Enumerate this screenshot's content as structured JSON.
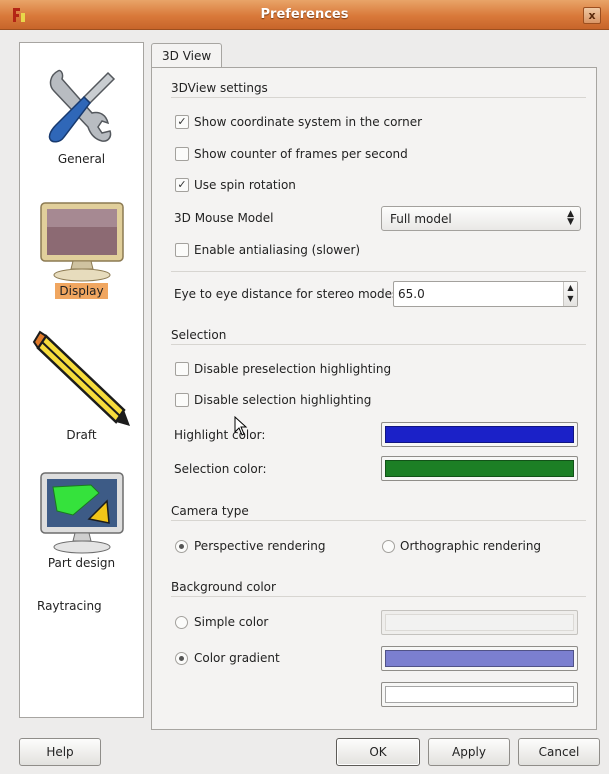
{
  "window": {
    "title": "Preferences",
    "close_glyph": "x"
  },
  "sidebar": {
    "items": [
      {
        "label": "General",
        "icon": "wrench-screwdriver-icon"
      },
      {
        "label": "Display",
        "icon": "monitor-icon",
        "selected": true
      },
      {
        "label": "Draft",
        "icon": "pencil-icon"
      },
      {
        "label": "Part design",
        "icon": "part-design-monitor-icon"
      },
      {
        "label": "Raytracing"
      }
    ]
  },
  "tabs": [
    {
      "label": "3D View"
    }
  ],
  "view3d": {
    "title": "3DView settings",
    "show_coordinate": {
      "label": "Show coordinate system in the corner",
      "checked": true,
      "glyph": "✓"
    },
    "show_fps": {
      "label": "Show counter of frames per second",
      "checked": false
    },
    "spin_rotation": {
      "label": "Use spin rotation",
      "checked": true,
      "glyph": "✓"
    },
    "mouse_model": {
      "label": "3D Mouse Model",
      "value": "Full model",
      "arrows": "▲\n▼"
    },
    "antialiasing": {
      "label": "Enable antialiasing (slower)",
      "checked": false
    },
    "eye_distance": {
      "label": "Eye to eye distance for stereo modes:",
      "value": "65.0",
      "arrows": "▲\n▼"
    }
  },
  "selection": {
    "title": "Selection",
    "disable_preselection": {
      "label": "Disable preselection highlighting",
      "checked": false
    },
    "disable_selection": {
      "label": "Disable selection highlighting",
      "checked": false
    },
    "highlight_color": {
      "label": "Highlight color:",
      "color": "#1b21c8"
    },
    "selection_color": {
      "label": "Selection color:",
      "color": "#1c7f25"
    }
  },
  "camera": {
    "title": "Camera type",
    "perspective": {
      "label": "Perspective rendering",
      "selected": true
    },
    "orthographic": {
      "label": "Orthographic rendering",
      "selected": false
    }
  },
  "background": {
    "title": "Background color",
    "simple": {
      "label": "Simple color",
      "selected": false,
      "color": "#f2f2f1"
    },
    "gradient": {
      "label": "Color gradient",
      "selected": true,
      "color_top": "#7b7fd0",
      "color_bottom": "#ffffff"
    }
  },
  "buttons": {
    "help": "Help",
    "ok": "OK",
    "apply": "Apply",
    "cancel": "Cancel"
  },
  "colors": {
    "titlebar": "#d9793a",
    "selected_item": "#f0a660"
  }
}
